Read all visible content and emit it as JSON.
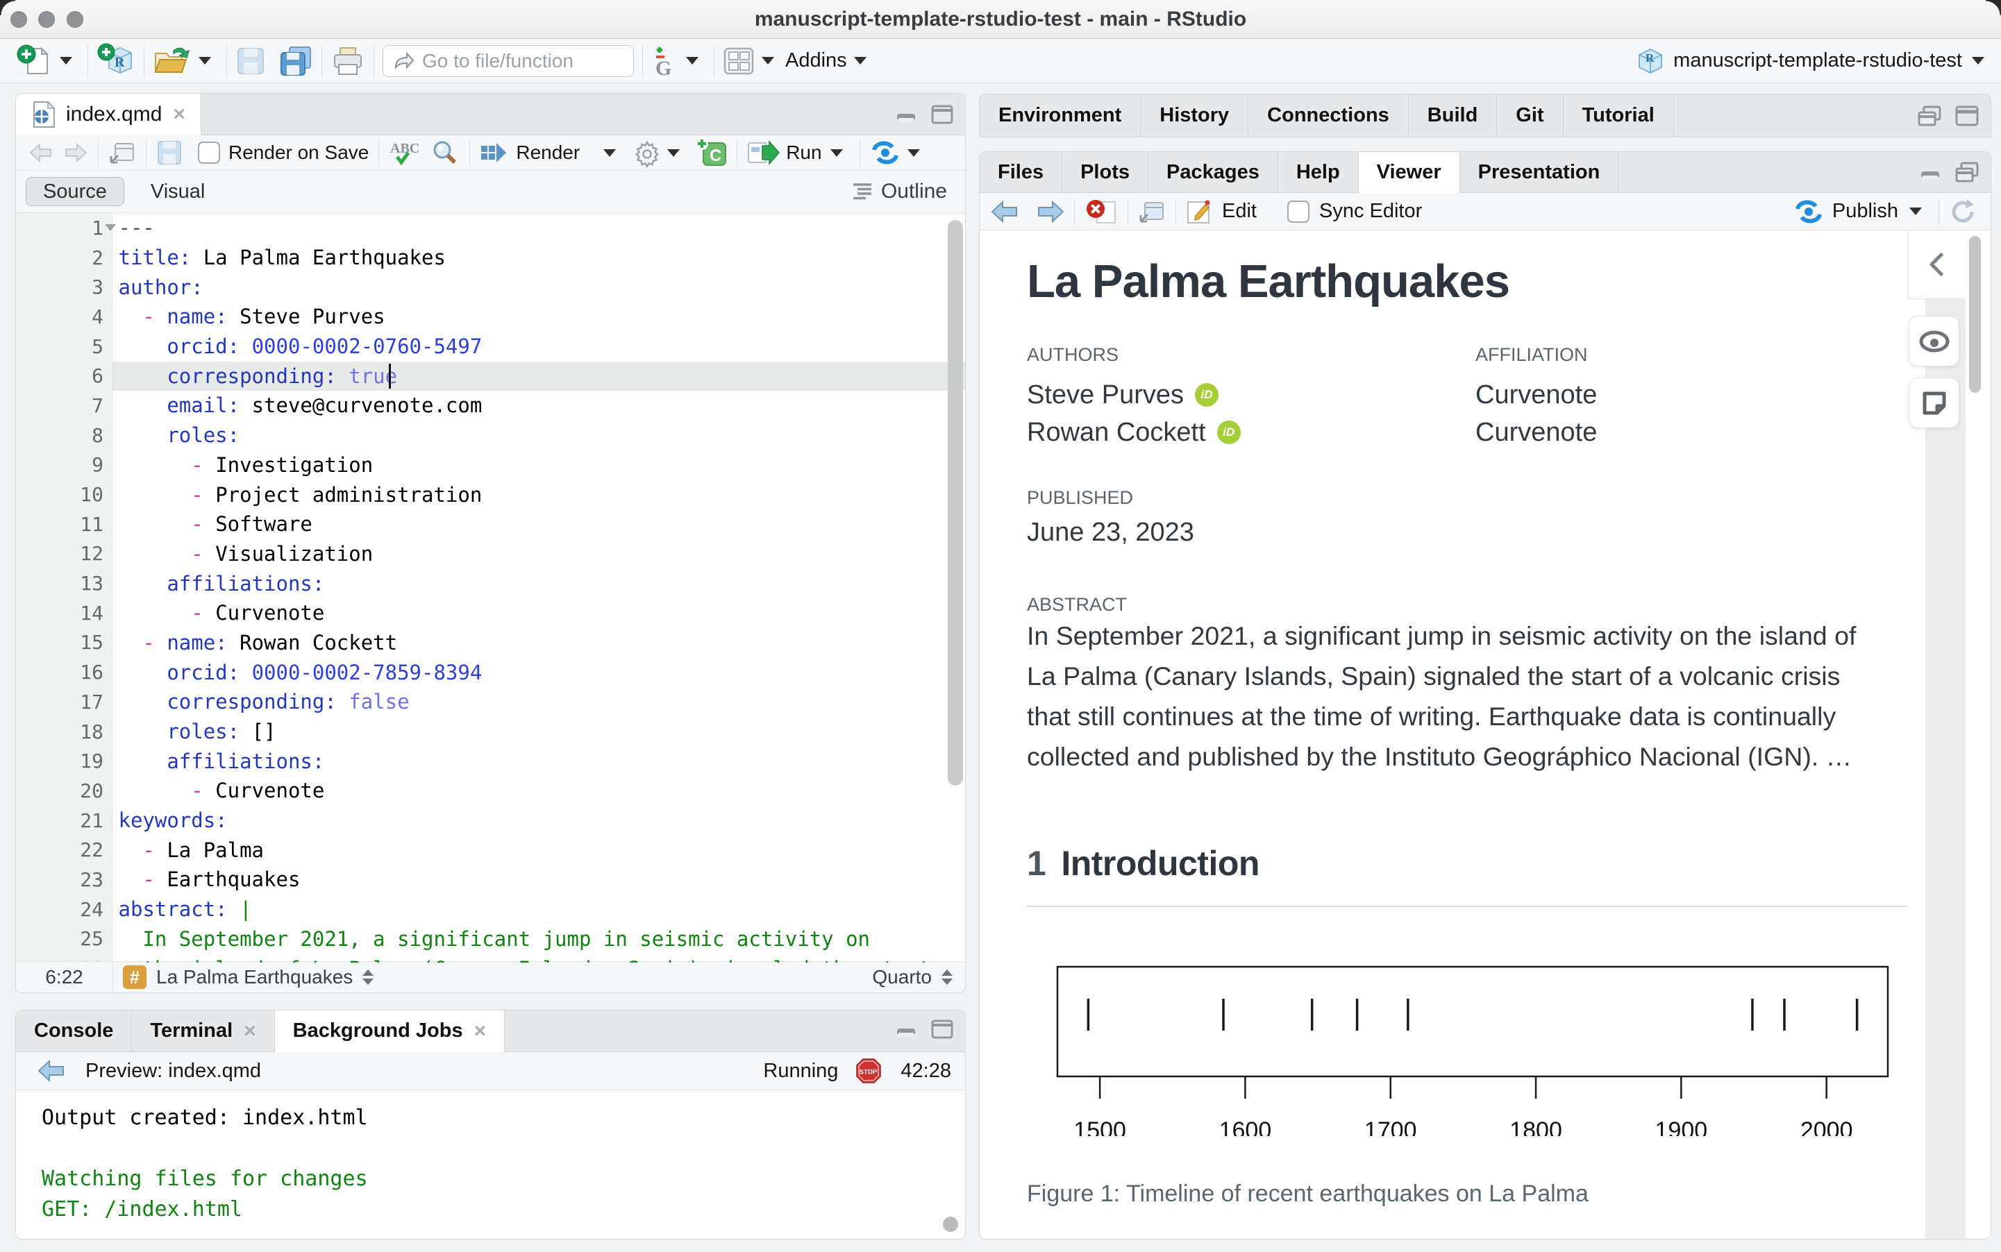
{
  "window": {
    "title": "manuscript-template-rstudio-test - main - RStudio"
  },
  "main_toolbar": {
    "goto_placeholder": "Go to file/function",
    "addins_label": "Addins",
    "project_label": "manuscript-template-rstudio-test"
  },
  "editor": {
    "tab_label": "index.qmd",
    "tab_close": "×",
    "render_on_save_label": "Render on Save",
    "render_label": "Render",
    "run_label": "Run",
    "source_label": "Source",
    "visual_label": "Visual",
    "outline_label": "Outline",
    "status": {
      "position": "6:22",
      "section": "La Palma Earthquakes",
      "mode": "Quarto"
    },
    "lines": [
      {
        "n": "1",
        "segs": [
          {
            "t": "---",
            "c": "m"
          }
        ]
      },
      {
        "n": "2",
        "segs": [
          {
            "t": "title:",
            "c": "k"
          },
          {
            "t": " La Palma Earthquakes",
            "c": "t"
          }
        ]
      },
      {
        "n": "3",
        "segs": [
          {
            "t": "author:",
            "c": "k"
          }
        ]
      },
      {
        "n": "4",
        "segs": [
          {
            "t": "  ",
            "c": "t"
          },
          {
            "t": "- ",
            "c": "d"
          },
          {
            "t": "name:",
            "c": "k"
          },
          {
            "t": " Steve Purves",
            "c": "t"
          }
        ]
      },
      {
        "n": "5",
        "segs": [
          {
            "t": "    ",
            "c": "t"
          },
          {
            "t": "orcid:",
            "c": "k"
          },
          {
            "t": " ",
            "c": "t"
          },
          {
            "t": "0000-0002-0760-5497",
            "c": "n"
          }
        ]
      },
      {
        "n": "6",
        "segs": [
          {
            "t": "    ",
            "c": "t"
          },
          {
            "t": "corresponding:",
            "c": "k"
          },
          {
            "t": " ",
            "c": "t"
          },
          {
            "t": "true",
            "c": "b"
          }
        ]
      },
      {
        "n": "7",
        "segs": [
          {
            "t": "    ",
            "c": "t"
          },
          {
            "t": "email:",
            "c": "k"
          },
          {
            "t": " steve@curvenote.com",
            "c": "t"
          }
        ]
      },
      {
        "n": "8",
        "segs": [
          {
            "t": "    ",
            "c": "t"
          },
          {
            "t": "roles:",
            "c": "k"
          }
        ]
      },
      {
        "n": "9",
        "segs": [
          {
            "t": "      ",
            "c": "t"
          },
          {
            "t": "- ",
            "c": "d"
          },
          {
            "t": "Investigation",
            "c": "t"
          }
        ]
      },
      {
        "n": "10",
        "segs": [
          {
            "t": "      ",
            "c": "t"
          },
          {
            "t": "- ",
            "c": "d"
          },
          {
            "t": "Project administration",
            "c": "t"
          }
        ]
      },
      {
        "n": "11",
        "segs": [
          {
            "t": "      ",
            "c": "t"
          },
          {
            "t": "- ",
            "c": "d"
          },
          {
            "t": "Software",
            "c": "t"
          }
        ]
      },
      {
        "n": "12",
        "segs": [
          {
            "t": "      ",
            "c": "t"
          },
          {
            "t": "- ",
            "c": "d"
          },
          {
            "t": "Visualization",
            "c": "t"
          }
        ]
      },
      {
        "n": "13",
        "segs": [
          {
            "t": "    ",
            "c": "t"
          },
          {
            "t": "affiliations:",
            "c": "k"
          }
        ]
      },
      {
        "n": "14",
        "segs": [
          {
            "t": "      ",
            "c": "t"
          },
          {
            "t": "- ",
            "c": "d"
          },
          {
            "t": "Curvenote",
            "c": "t"
          }
        ]
      },
      {
        "n": "15",
        "segs": [
          {
            "t": "  ",
            "c": "t"
          },
          {
            "t": "- ",
            "c": "d"
          },
          {
            "t": "name:",
            "c": "k"
          },
          {
            "t": " Rowan Cockett",
            "c": "t"
          }
        ]
      },
      {
        "n": "16",
        "segs": [
          {
            "t": "    ",
            "c": "t"
          },
          {
            "t": "orcid:",
            "c": "k"
          },
          {
            "t": " ",
            "c": "t"
          },
          {
            "t": "0000-0002-7859-8394",
            "c": "n"
          }
        ]
      },
      {
        "n": "17",
        "segs": [
          {
            "t": "    ",
            "c": "t"
          },
          {
            "t": "corresponding:",
            "c": "k"
          },
          {
            "t": " ",
            "c": "t"
          },
          {
            "t": "false",
            "c": "b"
          }
        ]
      },
      {
        "n": "18",
        "segs": [
          {
            "t": "    ",
            "c": "t"
          },
          {
            "t": "roles:",
            "c": "k"
          },
          {
            "t": " []",
            "c": "t"
          }
        ]
      },
      {
        "n": "19",
        "segs": [
          {
            "t": "    ",
            "c": "t"
          },
          {
            "t": "affiliations:",
            "c": "k"
          }
        ]
      },
      {
        "n": "20",
        "segs": [
          {
            "t": "      ",
            "c": "t"
          },
          {
            "t": "- ",
            "c": "d"
          },
          {
            "t": "Curvenote",
            "c": "t"
          }
        ]
      },
      {
        "n": "21",
        "segs": [
          {
            "t": "keywords:",
            "c": "k"
          }
        ]
      },
      {
        "n": "22",
        "segs": [
          {
            "t": "  ",
            "c": "t"
          },
          {
            "t": "- ",
            "c": "d"
          },
          {
            "t": "La Palma",
            "c": "t"
          }
        ]
      },
      {
        "n": "23",
        "segs": [
          {
            "t": "  ",
            "c": "t"
          },
          {
            "t": "- ",
            "c": "d"
          },
          {
            "t": "Earthquakes",
            "c": "t"
          }
        ]
      },
      {
        "n": "24",
        "segs": [
          {
            "t": "abstract:",
            "c": "k"
          },
          {
            "t": " |",
            "c": "s"
          }
        ]
      },
      {
        "n": "25",
        "segs": [
          {
            "t": "  In September 2021, a significant jump in seismic activity on",
            "c": "s"
          }
        ]
      },
      {
        "n": "26",
        "segs": [
          {
            "t": "  the island of La Palma (Canary Islands, Spain) signaled the start",
            "c": "s"
          }
        ]
      }
    ]
  },
  "console": {
    "tabs": [
      {
        "label": "Console",
        "close": "",
        "state": ""
      },
      {
        "label": "Terminal",
        "close": "×",
        "state": ""
      },
      {
        "label": "Background Jobs",
        "close": "×",
        "state": "active"
      }
    ],
    "preview_label": "Preview: index.qmd",
    "running_label": "Running",
    "stop_label": "STOP",
    "timer": "42:28",
    "output_lines": [
      {
        "t": "Output created: index.html",
        "c": ""
      },
      {
        "t": "",
        "c": ""
      },
      {
        "t": "Watching files for changes",
        "c": "green"
      },
      {
        "t": "GET: /index.html",
        "c": "green"
      }
    ]
  },
  "env_strip": {
    "tabs": [
      {
        "label": "Environment"
      },
      {
        "label": "History"
      },
      {
        "label": "Connections"
      },
      {
        "label": "Build"
      },
      {
        "label": "Git"
      },
      {
        "label": "Tutorial"
      }
    ]
  },
  "viewer": {
    "tabs": [
      {
        "label": "Files",
        "state": ""
      },
      {
        "label": "Plots",
        "state": ""
      },
      {
        "label": "Packages",
        "state": ""
      },
      {
        "label": "Help",
        "state": ""
      },
      {
        "label": "Viewer",
        "state": "active"
      },
      {
        "label": "Presentation",
        "state": ""
      }
    ],
    "edit_label": "Edit",
    "sync_label": "Sync Editor",
    "publish_label": "Publish"
  },
  "document": {
    "title": "La Palma Earthquakes",
    "authors_label": "AUTHORS",
    "affiliation_label": "AFFILIATION",
    "authors": [
      {
        "name": "Steve Purves",
        "orcid_badge": "iD",
        "affiliation": "Curvenote"
      },
      {
        "name": "Rowan Cockett",
        "orcid_badge": "iD",
        "affiliation": "Curvenote"
      }
    ],
    "published_label": "PUBLISHED",
    "published": "June 23, 2023",
    "abstract_label": "ABSTRACT",
    "abstract": "In September 2021, a significant jump in seismic activity on the island of La Palma (Canary Islands, Spain) signaled the start of a volcanic crisis that still continues at the time of writing. Earthquake data is continually collected and published by the Instituto Geográphico Nacional (IGN). …",
    "section_number": "1",
    "section_title": "Introduction",
    "figure_caption": "Figure 1: Timeline of recent earthquakes on La Palma"
  },
  "chart_data": {
    "type": "scatter",
    "title": "Timeline of recent earthquakes on La Palma",
    "marker": "|",
    "x": [
      1492,
      1585,
      1646,
      1677,
      1712,
      1949,
      1971,
      2021
    ],
    "y": [
      0,
      0,
      0,
      0,
      0,
      0,
      0,
      0
    ],
    "xlabel": "",
    "ylabel": "",
    "x_ticks": [
      1500,
      1600,
      1700,
      1800,
      1900,
      2000
    ],
    "xlim": [
      1470.8,
      2042.2
    ],
    "grid": false,
    "legend": false
  }
}
